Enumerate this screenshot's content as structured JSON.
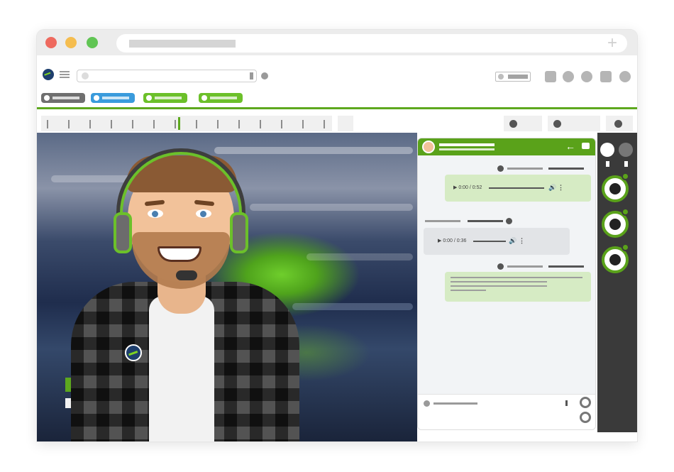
{
  "window": {
    "traffic_colors": [
      "#ee6a5f",
      "#f5bd4f",
      "#61c554"
    ],
    "accent": "#5da81e"
  },
  "toolbar": {
    "tab_colors": [
      "#6f6f6f",
      "#3a9bdc",
      "#6cc02a",
      "#6cc02a"
    ]
  },
  "chat": {
    "messages": [
      {
        "type": "audio",
        "from": "self",
        "time_text": "0:00 / 0:52"
      },
      {
        "type": "audio",
        "from": "other",
        "time_text": "0:00 / 0:36"
      },
      {
        "type": "text",
        "from": "self"
      }
    ]
  },
  "icons": {
    "close": "close-icon",
    "minimize": "minimize-icon",
    "maximize": "maximize-icon",
    "new_tab": "plus-icon",
    "logo": "logo-icon",
    "menu": "hamburger-icon",
    "back": "arrow-left-icon",
    "chat": "chat-bubble-icon",
    "play": "play-icon",
    "volume": "volume-icon",
    "more": "more-vertical-icon",
    "read": "check-circle-icon"
  }
}
